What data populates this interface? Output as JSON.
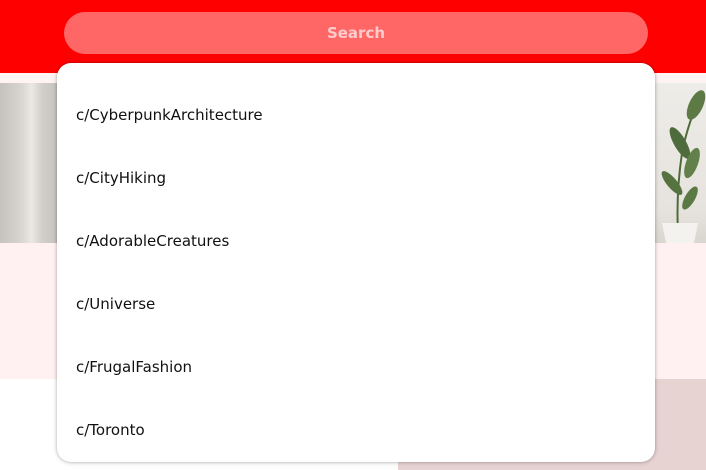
{
  "search": {
    "placeholder": "Search"
  },
  "suggestions": [
    "c/CyberpunkArchitecture",
    "c/CityHiking",
    "c/AdorableCreatures",
    "c/Universe",
    "c/FrugalFashion",
    "c/Toronto"
  ],
  "colors": {
    "header": "#ff0000",
    "search_bg": "#ff6666",
    "dropdown_bg": "#ffffff"
  }
}
